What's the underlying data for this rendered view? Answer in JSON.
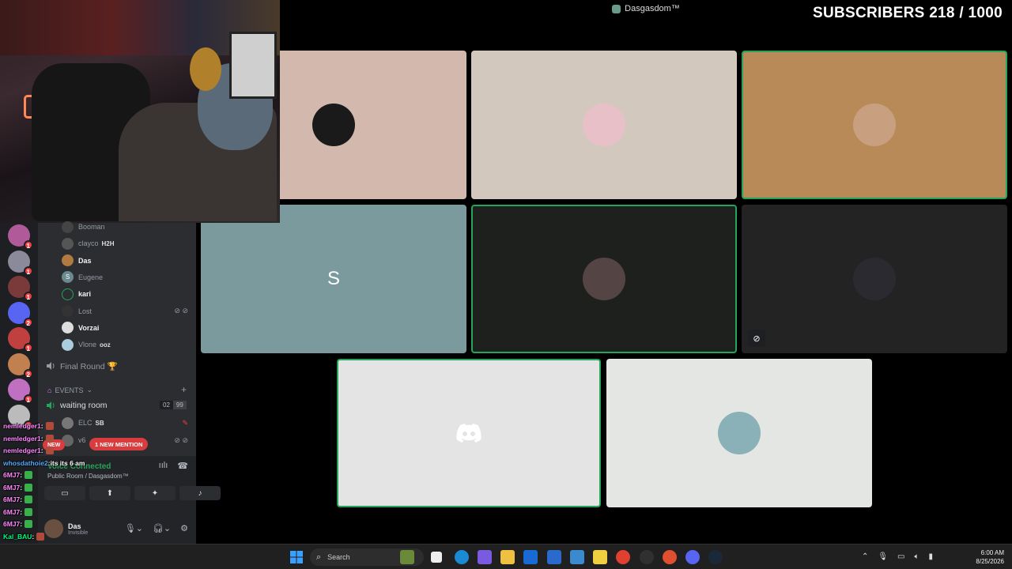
{
  "window": {
    "title": "Dasgasdom™"
  },
  "overlay": {
    "subscribers": "SUBSCRIBERS 218 / 1000"
  },
  "servers": [
    {
      "badge": "1",
      "color": "#b05a9a"
    },
    {
      "badge": "1",
      "color": "#8a8a9a"
    },
    {
      "badge": "1",
      "color": "#7a3a3a"
    },
    {
      "badge": "2",
      "color": "#5865f2"
    },
    {
      "badge": "1",
      "color": "#c04040"
    },
    {
      "badge": "2",
      "color": "#c08050"
    },
    {
      "badge": "1",
      "color": "#c070c0"
    },
    {
      "badge": "3",
      "color": "#bbbbbb"
    }
  ],
  "voice_users_top": [
    {
      "name": "Booman",
      "active": false,
      "av": "#444"
    },
    {
      "name": "clayco",
      "tag": "H2H",
      "active": false,
      "av": "#555"
    },
    {
      "name": "Das",
      "active": true,
      "av": "#b07a40"
    },
    {
      "name": "Eugene",
      "active": false,
      "letter": "S",
      "av": "#6a8a90"
    },
    {
      "name": "kari",
      "active": true,
      "av": "#2b2d31"
    },
    {
      "name": "Lost",
      "active": false,
      "av": "#333"
    },
    {
      "name": "Vorzai",
      "active": true,
      "av": "#dddddd"
    },
    {
      "name": "Vlone",
      "tag": "ooz",
      "active": false,
      "av": "#aaccdd"
    }
  ],
  "channels": {
    "final_round": "Final Round 🏆",
    "category": "EVENTS",
    "waiting_room": "waiting room",
    "waiting_counts": [
      "02",
      "99"
    ]
  },
  "waiting_users": [
    {
      "name": "ELC",
      "tag": "SB"
    },
    {
      "name": "v6"
    }
  ],
  "voice_panel": {
    "status": "Voice Connected",
    "location": "Public Room / Dasgasdom™"
  },
  "user": {
    "name": "Das",
    "status": "Invisible"
  },
  "mention_pill": "1 NEW MENTION",
  "new_pill": "NEW",
  "chat": [
    {
      "user": "nemledger1",
      "msg": "",
      "emote": true
    },
    {
      "user": "nemledger1",
      "msg": "",
      "emote": true
    },
    {
      "user": "nemledger1",
      "msg": "",
      "emote": true
    },
    {
      "user": "whosdathoie2",
      "msg": "its its 6 am",
      "emote": false
    },
    {
      "user": "6MJ7",
      "msg": "",
      "emote": true
    },
    {
      "user": "6MJ7",
      "msg": "",
      "emote": true
    },
    {
      "user": "6MJ7",
      "msg": "",
      "emote": true
    },
    {
      "user": "6MJ7",
      "msg": "",
      "emote": true
    },
    {
      "user": "6MJ7",
      "msg": "",
      "emote": true
    },
    {
      "user": "Kal_BAU",
      "msg": "",
      "emote": true
    },
    {
      "user": "Kal_BAU",
      "msg": "",
      "emote": true
    },
    {
      "user": "Kal_BAU",
      "msg": "",
      "emote": true
    }
  ],
  "tiles": [
    {
      "bg": "#d2b8ad",
      "speaking": false,
      "av": "#1a1a1a"
    },
    {
      "bg": "#d2c8be",
      "speaking": false,
      "av": "#e8c0c8"
    },
    {
      "bg": "#b88a58",
      "speaking": true,
      "av": "#c8a080"
    },
    {
      "bg": "#7a9a9e",
      "speaking": false,
      "letter": "S"
    },
    {
      "bg": "#1e201e",
      "speaking": true,
      "av": "#554444"
    },
    {
      "bg": "#232323",
      "speaking": false,
      "av": "#2a2a30",
      "camoff": true
    },
    {
      "bg": "#e4e4e4",
      "speaking": true,
      "discord": true
    },
    {
      "bg": "#e4e6e4",
      "speaking": false,
      "av": "#8ab0b8"
    }
  ],
  "taskbar": {
    "search_placeholder": "Search",
    "time": "6:00 AM",
    "date": "8/25/2026"
  }
}
